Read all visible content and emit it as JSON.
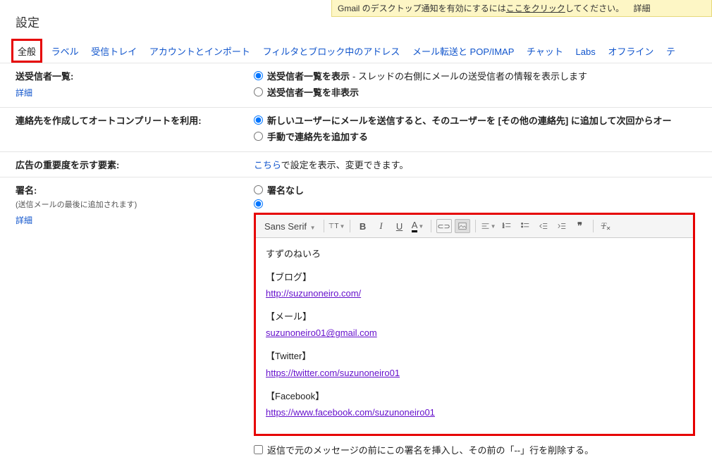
{
  "notification": {
    "prefix": "Gmail のデスクトップ通知を有効にするには",
    "link": "ここをクリック",
    "suffix": "してください。",
    "details": "詳細"
  },
  "page_title": "設定",
  "tabs": {
    "general": "全般",
    "labels": "ラベル",
    "inbox": "受信トレイ",
    "accounts": "アカウントとインポート",
    "filters": "フィルタとブロック中のアドレス",
    "forwarding": "メール転送と POP/IMAP",
    "chat": "チャット",
    "labs": "Labs",
    "offline": "オフライン",
    "themes": "テ"
  },
  "section_recipients": {
    "label": "送受信者一覧:",
    "details": "詳細",
    "opt_show_bold": "送受信者一覧を表示",
    "opt_show_desc": " - スレッドの右側にメールの送受信者の情報を表示します",
    "opt_hide": "送受信者一覧を非表示"
  },
  "section_autocomplete": {
    "label": "連絡先を作成してオートコンプリートを利用:",
    "opt_auto": "新しいユーザーにメールを送信すると、そのユーザーを [その他の連絡先] に追加して次回からオー",
    "opt_manual": "手動で連絡先を追加する"
  },
  "section_ads": {
    "label": "広告の重要度を示す要素:",
    "link_text": "こちら",
    "rest": "で設定を表示、変更できます。"
  },
  "section_signature": {
    "label": "署名:",
    "sub": "(送信メールの最後に追加されます)",
    "details": "詳細",
    "opt_none": "署名なし",
    "toolbar_font": "Sans Serif",
    "toolbar_size_icon": "тT",
    "body": {
      "name": "すずのねいろ",
      "blog_head": "【ブログ】",
      "blog_url": "http://suzunoneiro.com/",
      "mail_head": "【メール】",
      "mail_addr": "suzunoneiro01@gmail.com",
      "twitter_head": "【Twitter】",
      "twitter_url": "https://twitter.com/suzunoneiro01",
      "fb_head": "【Facebook】",
      "fb_url": "https://www.facebook.com/suzunoneiro01"
    },
    "checkbox_label": "返信で元のメッセージの前にこの署名を挿入し、その前の「--」行を削除する。"
  }
}
